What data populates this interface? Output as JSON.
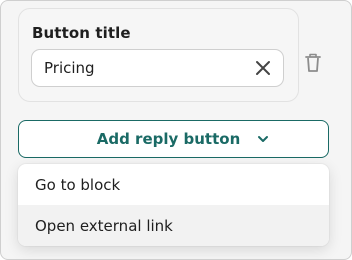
{
  "card": {
    "title": "Button title",
    "input_value": "Pricing"
  },
  "add_button": {
    "label": "Add reply button"
  },
  "dropdown": {
    "items": [
      {
        "label": "Go to block"
      },
      {
        "label": "Open external link"
      }
    ]
  },
  "icons": {
    "clear": "close-icon",
    "trash": "trash-icon",
    "chevron": "chevron-down-icon"
  },
  "colors": {
    "accent": "#1a6a65",
    "background": "#f5f5f5"
  }
}
